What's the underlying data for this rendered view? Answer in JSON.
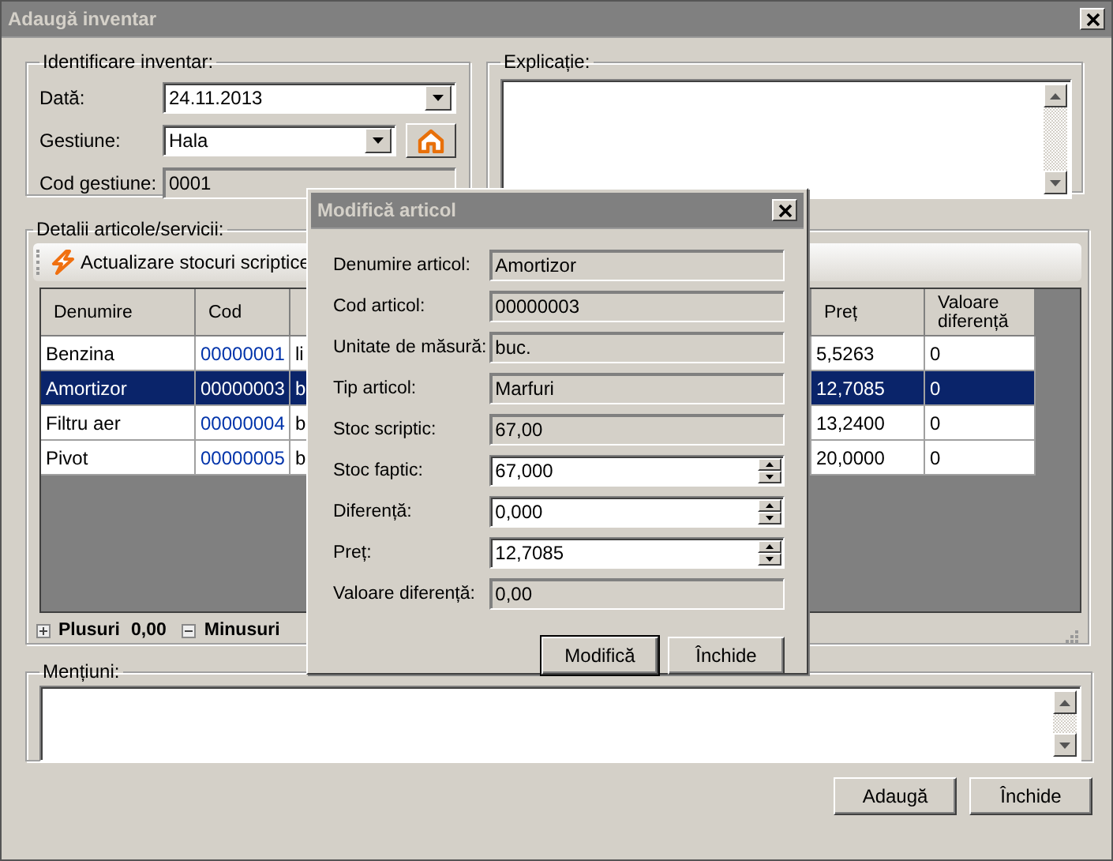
{
  "window": {
    "title": "Adaugă inventar"
  },
  "identification": {
    "legend": "Identificare inventar:",
    "fields": [
      {
        "label": "Dată:",
        "value": "24.11.2013",
        "kind": "dropdown"
      },
      {
        "label": "Gestiune:",
        "value": "Hala",
        "kind": "dropdown-button"
      },
      {
        "label": "Cod gestiune:",
        "value": "0001",
        "kind": "readonly"
      }
    ]
  },
  "explanation": {
    "legend": "Explicație:"
  },
  "details": {
    "legend": "Detalii articole/servicii:",
    "toolbar": [
      {
        "label": "Actualizare stocuri scriptice"
      }
    ],
    "table": {
      "columns": [
        {
          "label": "Denumire"
        },
        {
          "label": "Cod"
        },
        {},
        {
          "label": "Preț"
        },
        {
          "label": "Valoare diferență"
        }
      ],
      "rows": [
        {
          "cells": [
            "Benzina",
            "00000001",
            "li",
            "5,5263",
            "0"
          ],
          "selected": false
        },
        {
          "cells": [
            "Amortizor",
            "00000003",
            "b",
            "12,7085",
            "0"
          ],
          "selected": true
        },
        {
          "cells": [
            "Filtru aer",
            "00000004",
            "b",
            "13,2400",
            "0"
          ],
          "selected": false
        },
        {
          "cells": [
            "Pivot",
            "00000005",
            "b",
            "20,0000",
            "0"
          ],
          "selected": false
        }
      ]
    },
    "totals": [
      {
        "label": "Plusuri",
        "value": "0,00",
        "expanded": false
      },
      {
        "label": "Minusuri",
        "expanded": true
      }
    ]
  },
  "mentions": {
    "legend": "Mențiuni:"
  },
  "buttons": [
    "Adaugă",
    "Închide"
  ],
  "dialog": {
    "title": "Modifică articol",
    "fields": [
      {
        "label": "Denumire articol:",
        "value": "Amortizor",
        "kind": "readonly"
      },
      {
        "label": "Cod articol:",
        "value": "00000003",
        "kind": "readonly"
      },
      {
        "label": "Unitate de măsură:",
        "value": "buc.",
        "kind": "readonly"
      },
      {
        "label": "Tip articol:",
        "value": "Marfuri",
        "kind": "readonly"
      },
      {
        "label": "Stoc scriptic:",
        "value": "67,00",
        "kind": "readonly"
      },
      {
        "label": "Stoc faptic:",
        "value": "67,000",
        "kind": "spin"
      },
      {
        "label": "Diferență:",
        "value": "0,000",
        "kind": "spin"
      },
      {
        "label": "Preț:",
        "value": "12,7085",
        "kind": "spin"
      },
      {
        "label": "Valoare diferență:",
        "value": "0,00",
        "kind": "readonly"
      }
    ],
    "buttons": [
      {
        "label": "Modifică",
        "default": true
      },
      {
        "label": "Închide",
        "default": false
      }
    ]
  }
}
